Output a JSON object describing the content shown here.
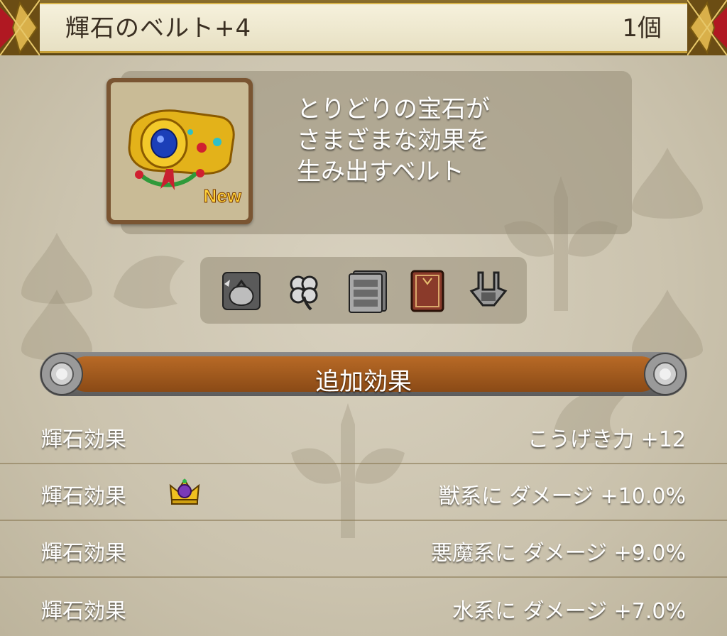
{
  "item": {
    "name": "輝石のベルト+4",
    "count": "1個",
    "badge": "New",
    "description": [
      "とりどりの宝石が",
      "さまざまな効果を",
      "生み出すベルト"
    ]
  },
  "equip_icons": [
    "bag-icon",
    "clover-icon",
    "chest-of-drawers-icon",
    "book-icon",
    "belt-icon"
  ],
  "effects_section": {
    "title": "追加効果",
    "rows": [
      {
        "label": "輝石効果",
        "value": "こうげき力 +12",
        "has_crown": false
      },
      {
        "label": "輝石効果",
        "value": "獣系に ダメージ +10.0%",
        "has_crown": true
      },
      {
        "label": "輝石効果",
        "value": "悪魔系に ダメージ +9.0%",
        "has_crown": false
      },
      {
        "label": "輝石効果",
        "value": "水系に ダメージ +7.0%",
        "has_crown": false
      }
    ]
  },
  "colors": {
    "header_gold": "#c8a13a",
    "banner_orange": "#a85d20",
    "text_white": "#ffffff"
  }
}
